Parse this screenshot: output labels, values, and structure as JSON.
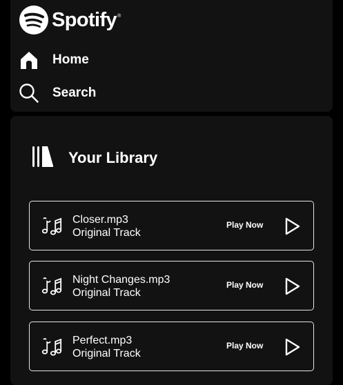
{
  "app": {
    "logo_text": "Spotify",
    "logo_reg": "®"
  },
  "nav": {
    "items": [
      {
        "label": "Home",
        "icon": "home-icon"
      },
      {
        "label": "Search",
        "icon": "search-icon"
      }
    ]
  },
  "library": {
    "title": "Your Library",
    "icon": "library-icon",
    "tracks": [
      {
        "name": "Closer.mp3",
        "subtitle": "Original Track",
        "action": "Play Now"
      },
      {
        "name": "Night Changes.mp3",
        "subtitle": "Original Track",
        "action": "Play Now"
      },
      {
        "name": "Perfect.mp3",
        "subtitle": "Original Track",
        "action": "Play Now"
      }
    ]
  },
  "colors": {
    "background": "#000000",
    "panel": "#121212",
    "text": "#ffffff",
    "card_border": "#e6e6e6"
  }
}
